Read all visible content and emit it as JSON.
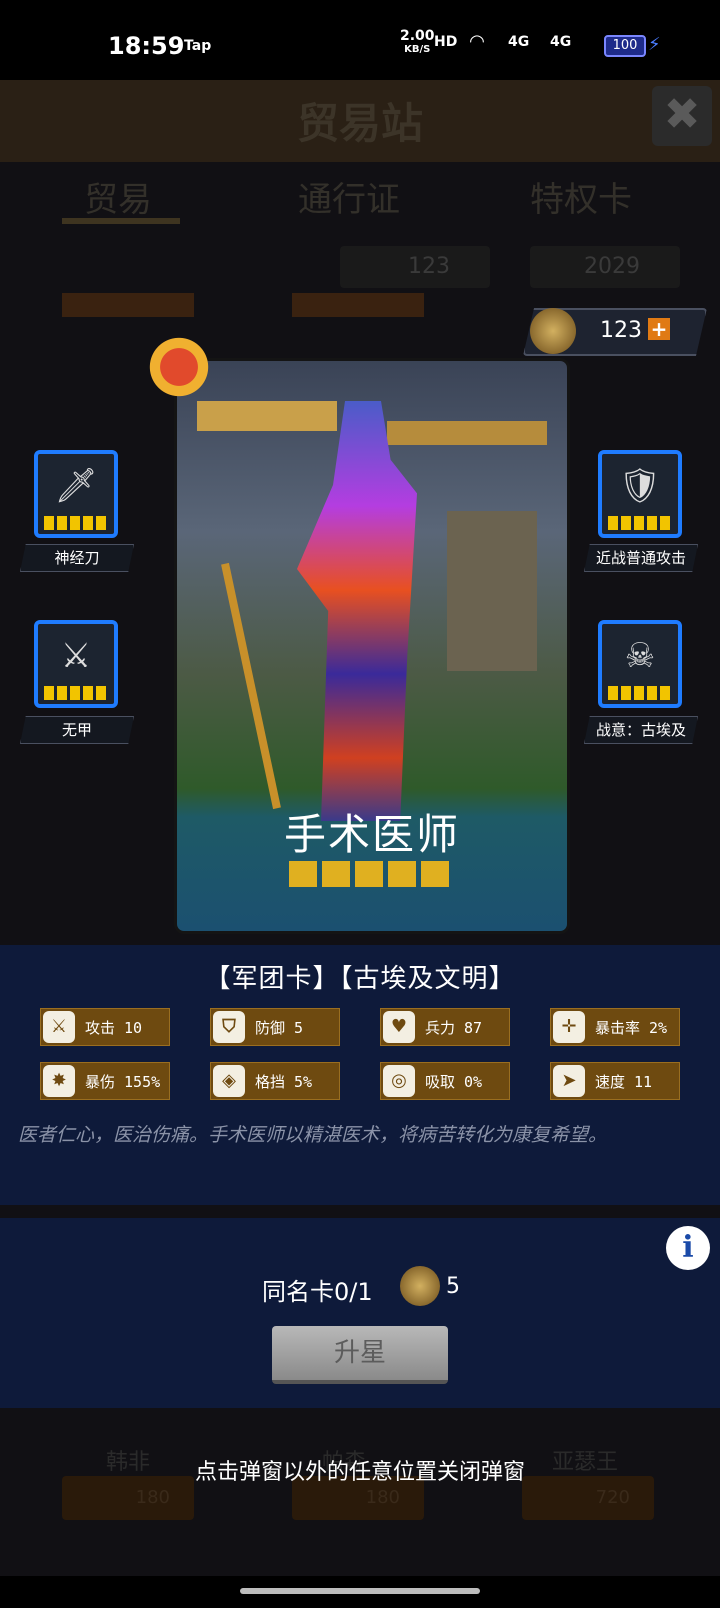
{
  "status_bar": {
    "time": "18:59",
    "app_tag": "Tap",
    "speed": "2.00",
    "speed_unit": "KB/S",
    "hd": "HD",
    "sig1": "4G",
    "sig2": "4G",
    "battery": "100"
  },
  "background": {
    "title": "贸易站",
    "tabs": [
      "贸易",
      "通行证",
      "特权卡"
    ],
    "currency1": "123",
    "currency2": "2029",
    "items": [
      "韩非",
      "帕森",
      "亚瑟王"
    ],
    "prices": [
      "180",
      "180",
      "720"
    ]
  },
  "chip": {
    "value": "123",
    "plus": "+"
  },
  "skills": {
    "left1": "神经刀",
    "left2": "无甲",
    "right1": "近战普通攻击",
    "right2": "战意：古埃及"
  },
  "card": {
    "name": "手术医师",
    "stars": 5
  },
  "tags": "【军团卡】【古埃及文明】",
  "stats": [
    {
      "label": "攻击 10",
      "icon": "sword-icon"
    },
    {
      "label": "防御 5",
      "icon": "shield-icon"
    },
    {
      "label": "兵力 87",
      "icon": "heart-icon"
    },
    {
      "label": "暴击率 2%",
      "icon": "crit-icon"
    },
    {
      "label": "暴伤 155%",
      "icon": "burst-icon"
    },
    {
      "label": "格挡 5%",
      "icon": "block-icon"
    },
    {
      "label": "吸取 0%",
      "icon": "drain-icon"
    },
    {
      "label": "速度 11",
      "icon": "boot-icon"
    }
  ],
  "description": "医者仁心，医治伤痛。手术医师以精湛医术，将病苦转化为康复希望。",
  "upgrade": {
    "dup_label": "同名卡0/1",
    "cost": "5",
    "button": "升星",
    "info": "i"
  },
  "hint": "点击弹窗以外的任意位置关闭弹窗"
}
